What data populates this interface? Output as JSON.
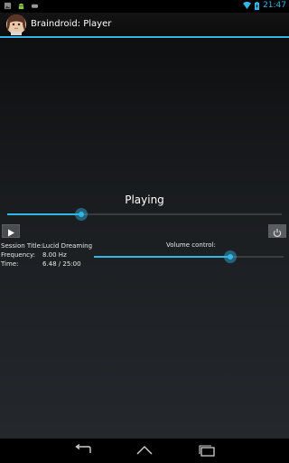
{
  "status_bar": {
    "time": "21:47",
    "icons": [
      "gallery-icon",
      "android-icon",
      "game-controller-icon",
      "wifi-icon",
      "battery-icon"
    ]
  },
  "action_bar": {
    "title": "Braindroid: Player",
    "icon": "avatar-icon"
  },
  "player": {
    "status": "Playing",
    "progress_fraction": 0.27,
    "session_title_label": "Session Title:",
    "session_title_value": "Lucid Dreaming",
    "frequency_label": "Frequency:",
    "frequency_value": "8.00 Hz",
    "time_label": "Time:",
    "time_value": "6.48 / 25:00",
    "volume_label": "Volume control:",
    "volume_fraction": 0.72,
    "play_icon": "play-icon",
    "power_icon": "power-icon"
  },
  "nav_bar": {
    "icons": [
      "back-icon",
      "home-icon",
      "recent-apps-icon"
    ]
  },
  "colors": {
    "accent": "#33b5e5",
    "background": "#000000"
  }
}
